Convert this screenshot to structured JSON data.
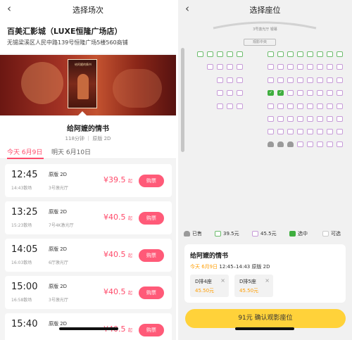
{
  "left": {
    "title": "选择场次",
    "cinema_name": "百美汇影城（LUXE恒隆广场店）",
    "cinema_address": "无锡梁溪区人民中路139号恒隆广场5楼560商铺",
    "poster_text": "给阿嬷的情书",
    "movie_title": "给阿嬷的情书",
    "movie_meta": "118分钟 ｜ 原版 2D",
    "tabs": [
      "今天 6月9日",
      "明天 6月10日"
    ],
    "showtimes": [
      {
        "start": "12:45",
        "end": "14:43散场",
        "version": "原版 2D",
        "hall": "3号激光厅",
        "price": "¥39.5",
        "suffix": "起",
        "buy": "购票"
      },
      {
        "start": "13:25",
        "end": "15:23散场",
        "version": "原版 2D",
        "hall": "7号4K激光厅",
        "price": "¥40.5",
        "suffix": "起",
        "buy": "购票"
      },
      {
        "start": "14:05",
        "end": "16:03散场",
        "version": "原版 2D",
        "hall": "6厅激光厅",
        "price": "¥40.5",
        "suffix": "起",
        "buy": "购票"
      },
      {
        "start": "15:00",
        "end": "16:58散场",
        "version": "原版 2D",
        "hall": "3号激光厅",
        "price": "¥40.5",
        "suffix": "起",
        "buy": "购票"
      },
      {
        "start": "15:40",
        "end": "",
        "version": "原版 2D",
        "hall": "",
        "price": "¥40.5",
        "suffix": "起",
        "buy": "购票"
      }
    ]
  },
  "right": {
    "title": "选择座位",
    "hall_name": "3号激光厅 银幕",
    "center_label": "观影中央",
    "legend": [
      "已售",
      "39.5元",
      "45.5元",
      "选中",
      "可选"
    ],
    "card": {
      "movie_title": "给阿嬷的情书",
      "date": "今天 6月9日",
      "time_format": "12:45–14:43 原版 2D"
    },
    "selected": [
      {
        "seat": "D排4座",
        "price": "45.50元",
        "remove": "×"
      },
      {
        "seat": "D排5座",
        "price": "45.50元",
        "remove": "×"
      }
    ],
    "confirm": "91元 确认观影座位"
  },
  "colors": {
    "accent": "#ff4a6a",
    "price_orange": "#ff9d00",
    "confirm_yellow": "#ffd23a",
    "selected_green": "#3fae3f",
    "seat_purple": "#c79bd8",
    "seat_green": "#6cbc6c"
  },
  "icons": [
    "back-arrow-icon",
    "seat-icon",
    "close-icon",
    "check-icon"
  ]
}
